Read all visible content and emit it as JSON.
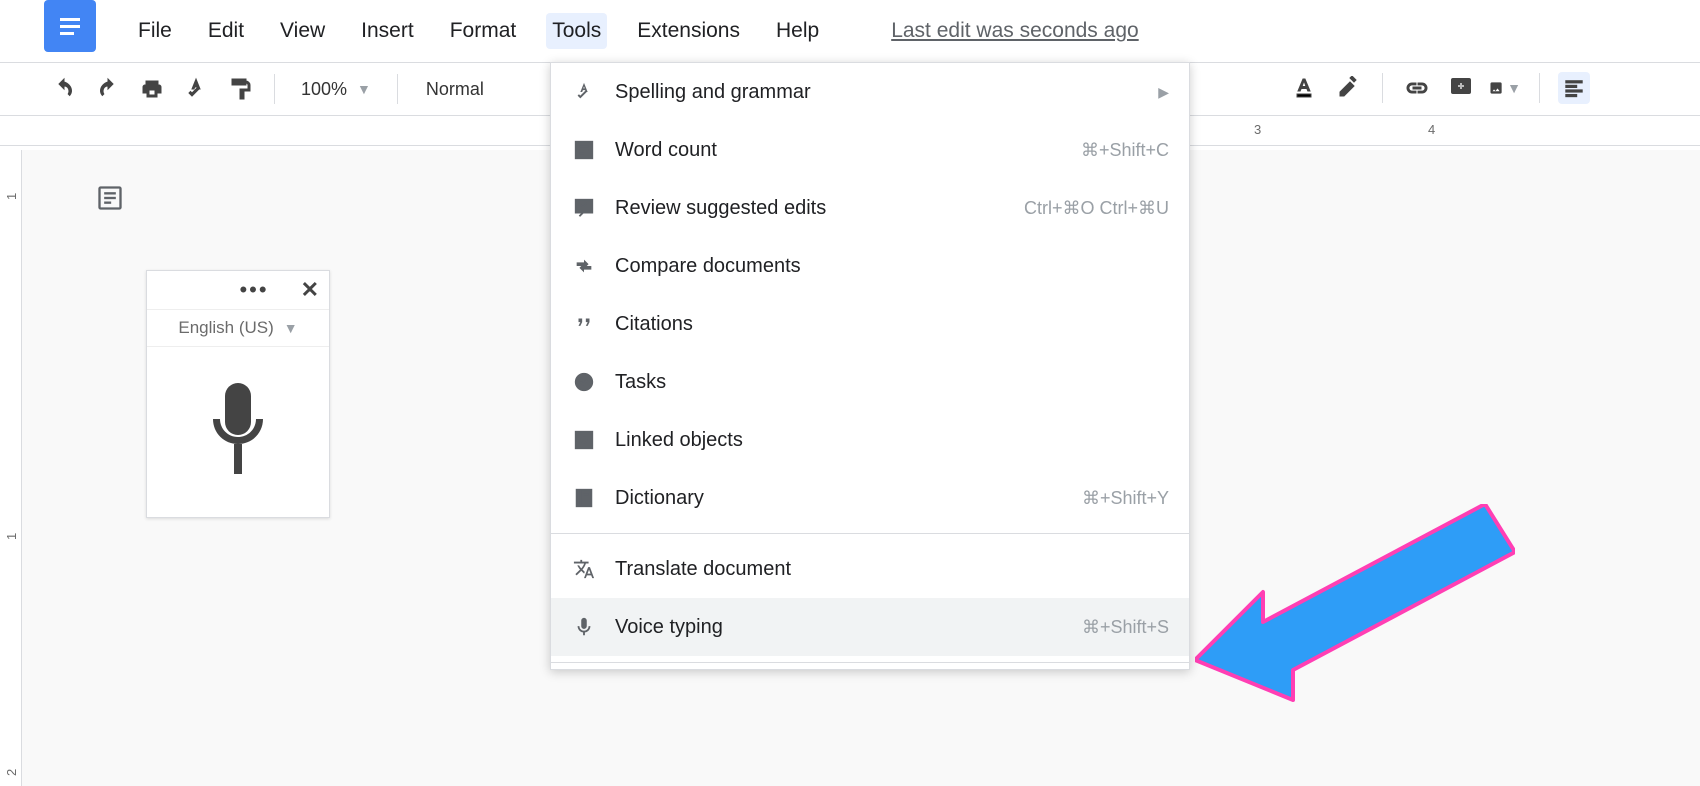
{
  "menubar": {
    "items": [
      "File",
      "Edit",
      "View",
      "Insert",
      "Format",
      "Tools",
      "Extensions",
      "Help"
    ],
    "active": "Tools"
  },
  "edit_status": "Last edit was seconds ago",
  "toolbar": {
    "zoom": "100%",
    "text_style": "Normal"
  },
  "voice_widget": {
    "language": "English (US)"
  },
  "tools_menu": {
    "items": [
      {
        "label": "Spelling and grammar",
        "shortcut": "",
        "submenu": true,
        "icon": "spellcheck"
      },
      {
        "label": "Word count",
        "shortcut": "⌘+Shift+C",
        "icon": "wordcount"
      },
      {
        "label": "Review suggested edits",
        "shortcut": "Ctrl+⌘O Ctrl+⌘U",
        "icon": "review"
      },
      {
        "label": "Compare documents",
        "shortcut": "",
        "icon": "compare"
      },
      {
        "label": "Citations",
        "shortcut": "",
        "icon": "citations"
      },
      {
        "label": "Tasks",
        "shortcut": "",
        "icon": "tasks"
      },
      {
        "label": "Linked objects",
        "shortcut": "",
        "icon": "linked"
      },
      {
        "label": "Dictionary",
        "shortcut": "⌘+Shift+Y",
        "icon": "dictionary"
      },
      {
        "label": "Translate document",
        "shortcut": "",
        "icon": "translate"
      },
      {
        "label": "Voice typing",
        "shortcut": "⌘+Shift+S",
        "icon": "mic",
        "highlight": true
      }
    ]
  },
  "ruler": {
    "marks": [
      "3",
      "4"
    ],
    "vmarks": [
      "1",
      "1",
      "2"
    ]
  }
}
